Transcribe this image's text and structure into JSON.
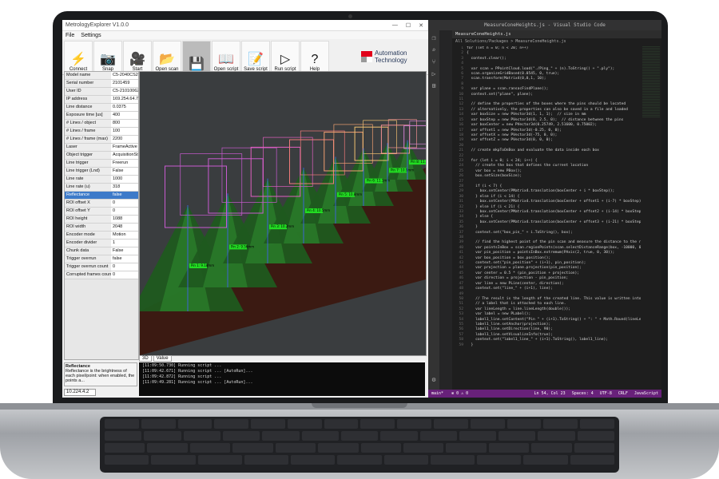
{
  "app": {
    "title": "MetrologyExplorer V1.0.0",
    "menu": [
      "File",
      "Settings"
    ],
    "toolbar": [
      {
        "label": "Connect",
        "icon": "plug-icon",
        "glyph": "⚡"
      },
      {
        "label": "Snap",
        "icon": "camera-icon",
        "glyph": "📷"
      },
      {
        "label": "Start",
        "icon": "video-camera-icon",
        "glyph": "🎥"
      },
      {
        "label": "Open scan",
        "icon": "folder-icon",
        "glyph": "📂"
      },
      {
        "label": "",
        "icon": "save-icon",
        "glyph": "💾"
      },
      {
        "label": "Open script",
        "icon": "book-icon",
        "glyph": "📖"
      },
      {
        "label": "Save script",
        "icon": "script-save-icon",
        "glyph": "📝"
      },
      {
        "label": "Run script",
        "icon": "play-icon",
        "glyph": "▷"
      },
      {
        "label": "Help",
        "icon": "question-icon",
        "glyph": "?"
      }
    ],
    "logo_line1": "Automation",
    "logo_line2": "Technology",
    "properties": [
      {
        "k": "Model name",
        "v": "C5-2040CS2-"
      },
      {
        "k": "Serial number",
        "v": "2101459"
      },
      {
        "k": "User ID",
        "v": "C5-21010062"
      },
      {
        "k": "IP address",
        "v": "169.254.64.7"
      },
      {
        "k": "Line distance",
        "v": "0.0375"
      },
      {
        "k": "Exposure time [us]",
        "v": "400"
      },
      {
        "k": "# Lines / object",
        "v": "800"
      },
      {
        "k": "# Lines / frame",
        "v": "100"
      },
      {
        "k": "# Lines / frame (max)",
        "v": "2200"
      },
      {
        "k": "Laser",
        "v": "FrameActive"
      },
      {
        "k": "Object trigger",
        "v": "AcquisitionStar"
      },
      {
        "k": "Line trigger",
        "v": "Freerun"
      },
      {
        "k": "Line trigger (Lnd)",
        "v": "False"
      },
      {
        "k": "Line rate",
        "v": "1000"
      },
      {
        "k": "Line rate (u)",
        "v": "318"
      },
      {
        "k": "Reflectance",
        "v": "false"
      },
      {
        "k": "ROI offset X",
        "v": "0"
      },
      {
        "k": "ROI offset Y",
        "v": "0"
      },
      {
        "k": "ROI height",
        "v": "1088"
      },
      {
        "k": "ROI width",
        "v": "2048"
      },
      {
        "k": "Encoder mode",
        "v": "Motion"
      },
      {
        "k": "Encoder divider",
        "v": "1"
      },
      {
        "k": "Chunk data",
        "v": "False"
      },
      {
        "k": "Trigger overrun",
        "v": "false"
      },
      {
        "k": "Trigger overrun count",
        "v": "0"
      },
      {
        "k": "Corrupted frames count",
        "v": "0"
      }
    ],
    "help_title": "Reflectance",
    "help_text": "Reflectance is the brightness of each pixel/point: when enabled, the points a...",
    "ip_field": "10.224.4.2",
    "view_tabs": [
      "3D",
      "Value"
    ],
    "console_lines": [
      "[11:09:50.730] Running script ...",
      "[11:09:42.671] Running script ... [AutoRun]...",
      "[11:09:42.872] Running script ...",
      "[11:09:49.281] Running script ... [AutoRun]..."
    ],
    "box_labels": [
      "Pin 1: 9.18mm",
      "Pin 2: 9.56mm",
      "Pin 3: 10.2mm",
      "Pin 4: 10.5mm",
      "Pin 5: 10.8mm",
      "Pin 6: 11.1mm",
      "Pin 7: 10.9mm",
      "Pin 8: 11.4mm"
    ]
  },
  "vscode": {
    "title": "MeasureConeHeights.js - Visual Studio Code",
    "tab": "MeasureConeHeights.js",
    "breadcrumb": "All Solutions/Packages > MeasureConeHeights.js",
    "activity_icons": [
      "files-icon",
      "search-icon",
      "source-control-icon",
      "run-icon",
      "extensions-icon"
    ],
    "code": [
      "for (let n = 0; n < 20; n++)",
      "{",
      "  context.clear();",
      "",
      "  var scan = PPointCloud.load(\"./Ping_\" + (n).ToString() + \".ply\");",
      "  scan.organizeGridBased(0.0545, 0, true);",
      "  scan.transform(Matrix4(0,0,1, 10);",
      "",
      "  var plane = scan.ransacFindPlane();",
      "  context.set(\"plane\", plane);",
      "",
      "  // define the properties of the boxes where the pins should be located",
      "  // alternatively, the properties can also be saved in a file and loaded",
      "  var boxSize = new PVector3d(1, 1, 1);  // size in mm",
      "  var boxStep = new PVector3d(0, 2.5, 0);  // distance between the pins",
      "  var boxCenter = new PVector3d(0.25749, 2.51600, 0.75002);",
      "  var offset1 = new PVector3d(-0.25, 0, 0);",
      "  var offsetX = new PVector3d(-75, 0, 0);",
      "  var offsetZ = new PVector3d(0, 0, 0);",
      "",
      "  // create mkpToOnBox and evaluate the data inside each box",
      "",
      "  for (let i = 0; i < 24; i++) {",
      "    // create the box that defines the current location",
      "    var box = new PBox();",
      "    box.setSize(boxSize);",
      "",
      "    if (i < 7) {",
      "      box.setCenter(PMatrix4.translation(boxCenter + i * boxStep));",
      "    } else if (i < 14) {",
      "      box.setCenter(PMatrix4.translation(boxCenter + offset1 + (i-7) * boxStep));",
      "    } else if (i < 21) {",
      "      box.setCenter(PMatrix4.translation(boxCenter + offset2 + (i-14) * boxStep));",
      "    } else {",
      "      box.setCenter(PMatrix4.translation(boxCenter + offset3 + (i-21) * boxStep));",
      "    }",
      "    context.set(\"box_pin_\" + i.ToString(), box);",
      "",
      "    // find the highest point of the pin scan and measure the distance to the reference plane",
      "    var pointsInBox = scan.regionPoints(scan.selectDistanceRange(box, -10000, 0));",
      "    var pin_position = pointsInBox.extremum(PAxis(2, true, 0, 30));",
      "    var box_position = box.position();",
      "    context.set(\"pin_position\" + (i+1), pin_position);",
      "    var projection = plane.projection(pin_position);",
      "    var center = 0.5 * (pin_position + projection);",
      "    var direction = projection - pin_position;",
      "    var line = new PLine(center, direction);",
      "    context.set(\"line_\" + (i+1), line);",
      "",
      "    // The result is the length of the created line. This value is written into",
      "    // a label that is attached to each line.",
      "    var lineLength = line.lineLength(double());",
      "    var label = new PLabel();",
      "    label1_line.setContent(\"Pin \" + (i+1).ToString() + \": \" + Math.Round(lineLength, 2) + \" mm\");",
      "    label1_line.setAnchor(projection);",
      "    label1_line.setDirection(line, 90);",
      "    label1_line.setVisualizeInfo(true);",
      "    context.set(\"label1_line_\" + (i+1).ToString(), label1_line);",
      "  }"
    ],
    "status_left": [
      "main*",
      "⊗ 0 ⚠ 0"
    ],
    "status_right": [
      "Ln 54, Col 23",
      "Spaces: 4",
      "UTF-8",
      "CRLF",
      "JavaScript"
    ]
  }
}
